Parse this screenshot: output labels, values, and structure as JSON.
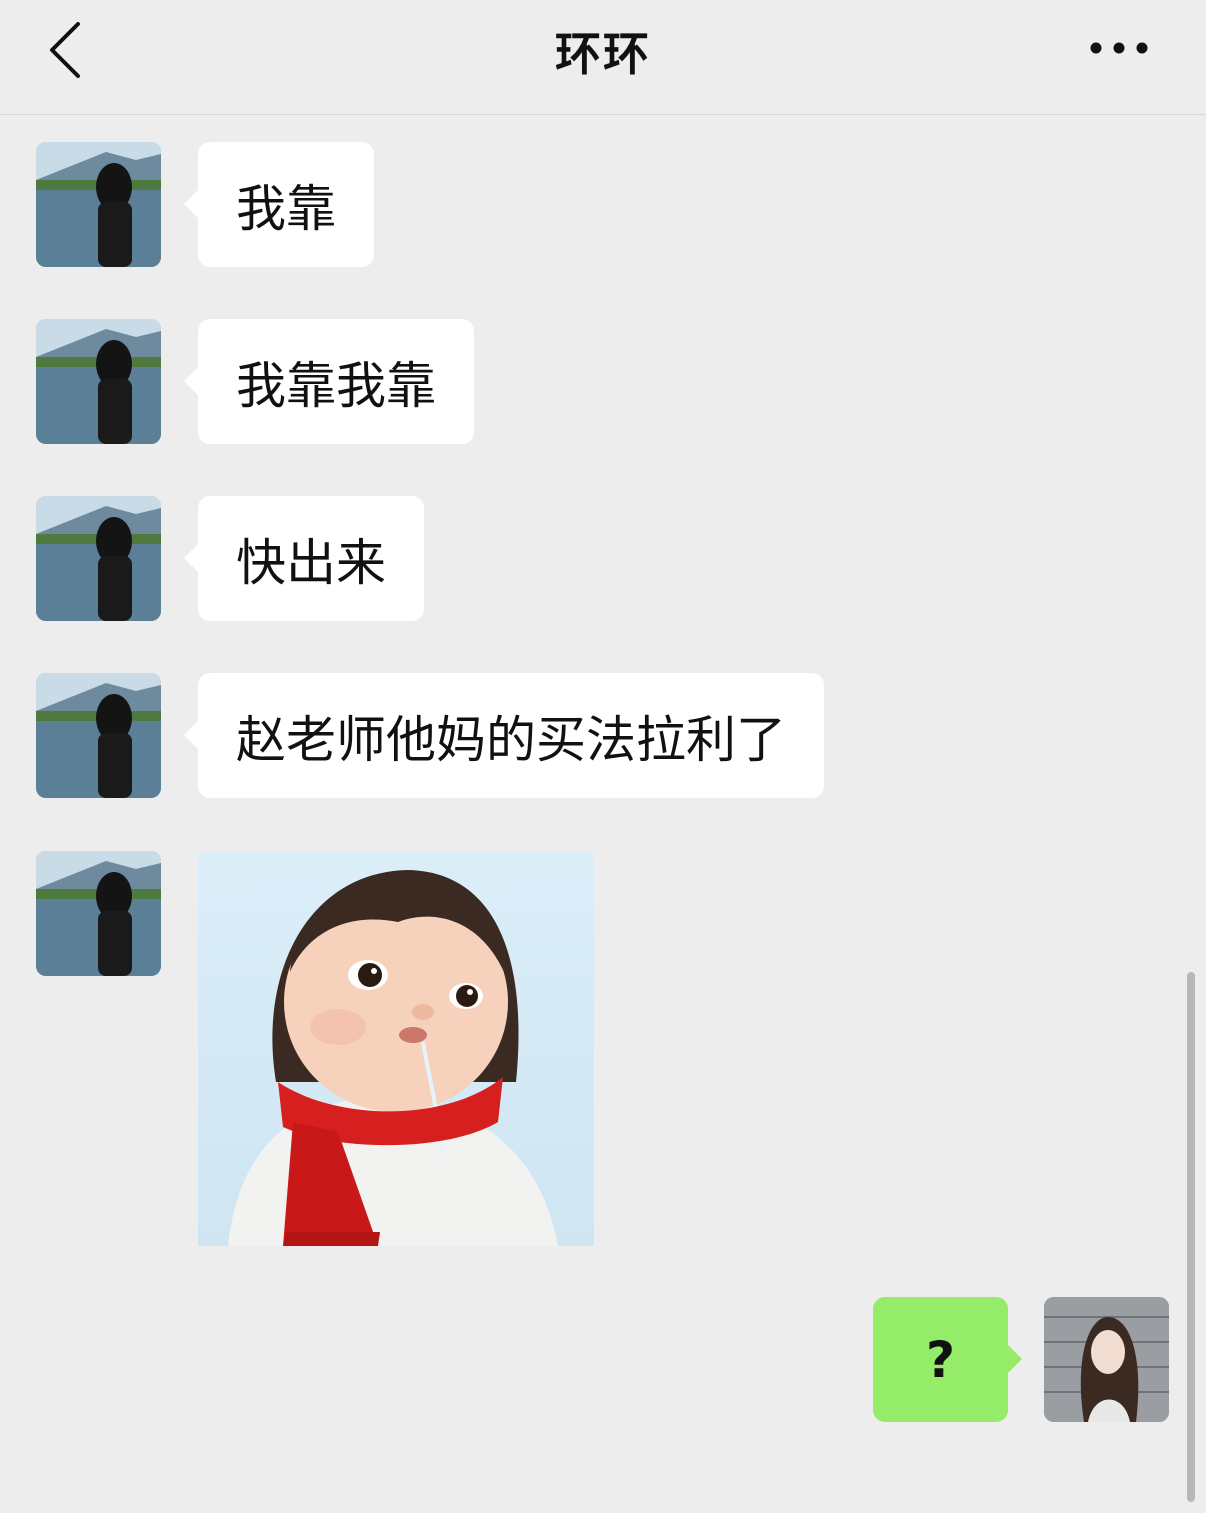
{
  "header": {
    "title": "环环",
    "back_icon": "chevron-left-icon",
    "more_icon": "more-dots-icon"
  },
  "messages": [
    {
      "sender": "contact",
      "type": "text",
      "text": "我靠"
    },
    {
      "sender": "contact",
      "type": "text",
      "text": "我靠我靠"
    },
    {
      "sender": "contact",
      "type": "text",
      "text": "快出来"
    },
    {
      "sender": "contact",
      "type": "text",
      "text": "赵老师他妈的买法拉利了"
    },
    {
      "sender": "contact",
      "type": "sticker",
      "description": "cartoon girl with red scarf drooling"
    },
    {
      "sender": "me",
      "type": "text",
      "text": "?"
    }
  ],
  "colors": {
    "background": "#ededed",
    "incoming_bubble": "#ffffff",
    "outgoing_bubble": "#95ec69"
  }
}
